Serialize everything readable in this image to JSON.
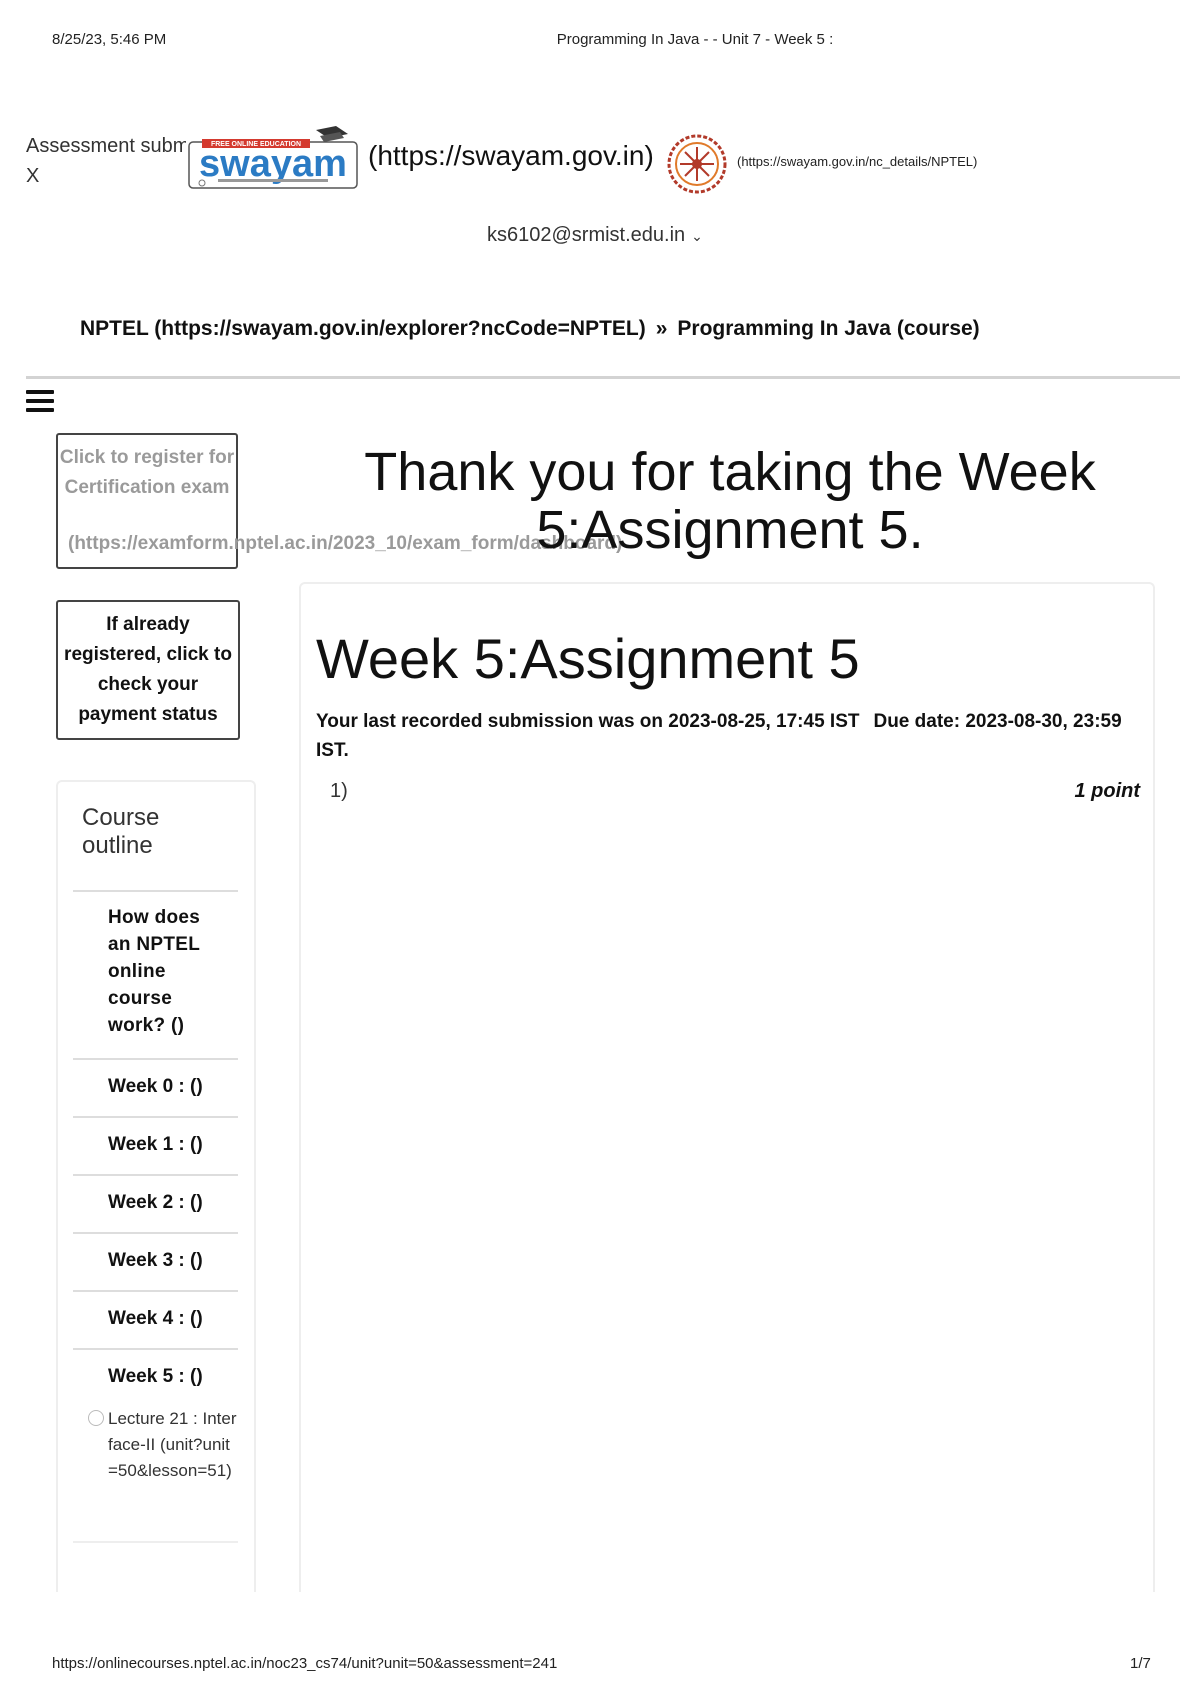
{
  "print_header": {
    "date": "8/25/23, 5:46 PM",
    "title": "Programming In Java - - Unit 7 - Week 5 :"
  },
  "toast": {
    "text": "Assessment submitted.",
    "close": "X"
  },
  "logos": {
    "swayam_logo_icon": "swayam-logo",
    "swayam_tagline": "FREE ONLINE EDUCATION",
    "swayam_wordmark": "swayam",
    "swayam_link": "(https://swayam.gov.in)",
    "nptel_logo_icon": "nptel-logo",
    "nptel_link": "(https://swayam.gov.in/nc_details/NPTEL)"
  },
  "user": {
    "email": "ks6102@srmist.edu.in",
    "chevron_icon": "chevron-down-icon"
  },
  "breadcrumb": {
    "nptel": "NPTEL (https://swayam.gov.in/explorer?ncCode=NPTEL)",
    "separator": "»",
    "course": "Programming In Java (course)"
  },
  "sidebar": {
    "menu_icon": "hamburger-menu-icon",
    "register_button": "Click to register for Certification exam",
    "register_url": "(https://examform.nptel.ac.in/2023_10/exam_form/dashboard)",
    "payment_button": "If already registered, click to check your payment status",
    "outline_title": "Course outline",
    "outline_items": [
      "How does an NPTEL online course work? ()",
      "Week 0 : ()",
      "Week 1 : ()",
      "Week 2 : ()",
      "Week 3 : ()",
      "Week 4 : ()",
      "Week 5 : ()"
    ],
    "lesson": "Lecture 21 : Interface-II (unit?unit=50&lesson=51)"
  },
  "main": {
    "thank_you": "Thank you for taking the Week 5:Assignment 5.",
    "assignment_title": "Week 5:Assignment 5",
    "submission_text": "Your last recorded submission was on 2023-08-25, 17:45 IST",
    "due_date": "Due date: 2023-08-30, 23:59 IST.",
    "question_number": "1)",
    "question_points": "1 point"
  },
  "print_footer": {
    "url": "https://onlinecourses.nptel.ac.in/noc23_cs74/unit?unit=50&assessment=241",
    "page": "1/7"
  }
}
